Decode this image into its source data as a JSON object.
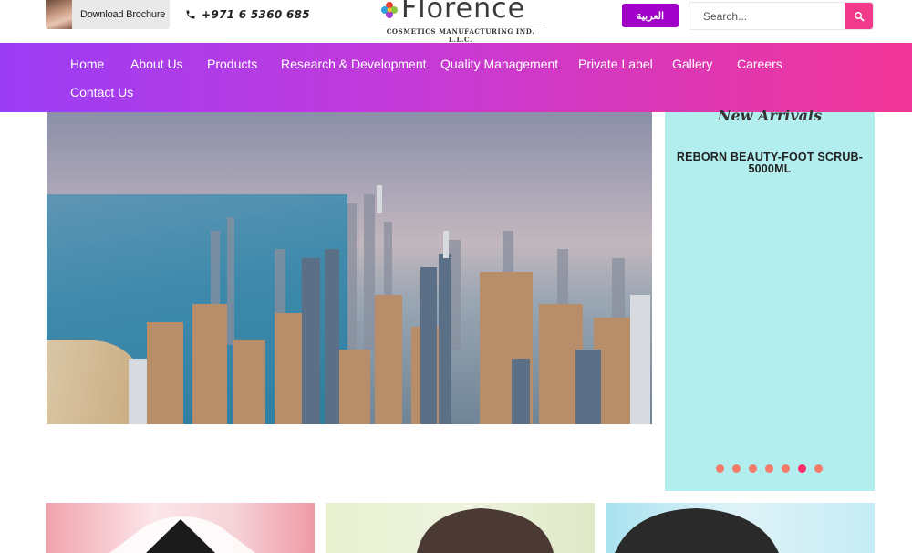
{
  "header": {
    "brochure_label": "Download Brochure",
    "phone": "+971 6 5360 685",
    "logo_text": "Florence",
    "logo_tagline": "COSMETICS MANUFACTURING IND. L.L.C.",
    "arabic_label": "العربية",
    "search_placeholder": "Search..."
  },
  "nav": {
    "items": [
      {
        "label": "About Us"
      },
      {
        "label": "Products"
      },
      {
        "label": "Research & Development"
      },
      {
        "label": "Quality Management"
      },
      {
        "label": "Private Label"
      },
      {
        "label": "Gallery"
      },
      {
        "label": "Careers"
      }
    ],
    "home": "Home",
    "contact": "Contact Us"
  },
  "arrivals": {
    "title": "New Arrivals",
    "product": "REBORN BEAUTY-FOOT SCRUB-5000ML",
    "slide_count": 7,
    "active_slide": 6
  },
  "colors": {
    "nav_gradient_start": "#9b3df5",
    "nav_gradient_end": "#f23596",
    "arabic_button": "#a000c8",
    "search_button": "#f33a8a",
    "arrivals_bg": "#b2eeee",
    "slider_dot": "#f27b6a",
    "slider_dot_active": "#ff2a6a"
  },
  "icons": {
    "phone": "phone-icon",
    "search": "search-icon",
    "logo": "flower-logo-icon"
  }
}
